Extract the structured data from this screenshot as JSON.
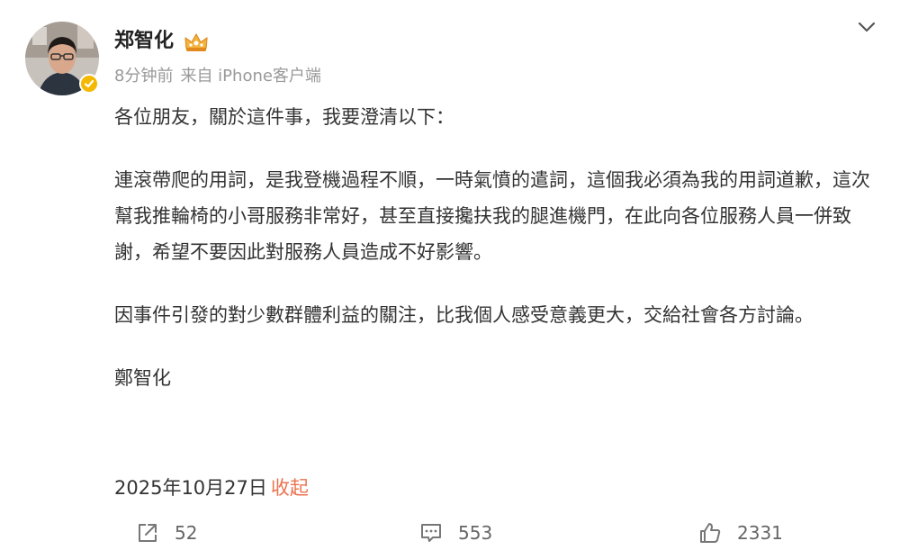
{
  "post": {
    "author": "郑智化",
    "time": "8分钟前",
    "source": "来自 iPhone客户端",
    "paragraphs": [
      "各位朋友，關於這件事，我要澄清以下：",
      "連滾帶爬的用詞，是我登機過程不順，一時氣憤的遣詞，這個我必須為我的用詞道歉，這次幫我推輪椅的小哥服務非常好，甚至直接攙扶我的腿進機門，在此向各位服務人員一併致謝，希望不要因此對服務人員造成不好影響。",
      "因事件引發的對少數群體利益的關注，比我個人感受意義更大，交給社會各方討論。",
      "鄭智化"
    ],
    "date": "2025年10月27日",
    "collapse_label": "收起"
  },
  "actions": {
    "repost_count": "52",
    "comment_count": "553",
    "like_count": "2331"
  },
  "colors": {
    "accent_link": "#eb7350",
    "verified_badge": "#f5b800",
    "meta_text": "#999999"
  },
  "icons": {
    "menu": "chevron-down-icon",
    "badge": "crown-icon",
    "verified": "verified-badge-icon",
    "repost": "repost-icon",
    "comment": "comment-icon",
    "like": "like-icon"
  }
}
